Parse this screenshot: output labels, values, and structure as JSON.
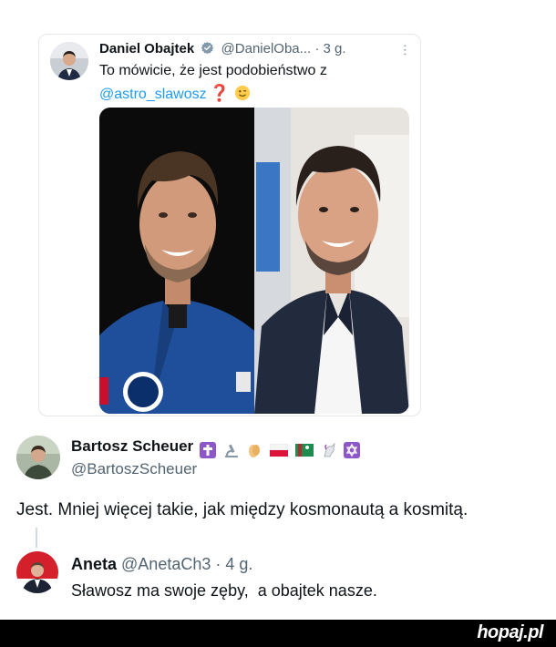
{
  "tweet": {
    "author_name": "Daniel Obajtek",
    "author_handle": "@DanielOba...",
    "separator": "·",
    "time": "3 g.",
    "text_part1": "To mówicie, że jest podobieństwo z",
    "mention": "@astro_slawosz",
    "question_emoji": "❓",
    "icons": [
      "verified-badge-icon",
      "more-options-icon",
      "winking-face-icon"
    ]
  },
  "reply": {
    "author_name": "Bartosz Scheuer",
    "author_handle": "@BartoszScheuer",
    "text": "Jest. Mniej więcej takie, jak między kosmonautą a kosmitą.",
    "name_emojis": [
      "cross-icon",
      "microscope-icon",
      "clapping-hands-icon",
      "poland-flag-icon",
      "turkmenistan-flag-icon",
      "unicorn-icon",
      "star-of-david-icon"
    ]
  },
  "nested_reply": {
    "author_name": "Aneta",
    "author_handle": "@AnetaCh3",
    "separator": "·",
    "time": "4 g.",
    "text": "Sławosz ma swoje zęby,  a obajtek nasze."
  },
  "footer": {
    "logo": "hopaj.pl"
  },
  "colors": {
    "link": "#1d9bf0",
    "secondary_text": "#536471",
    "verified": "#829aab",
    "footer_bg": "#000000"
  }
}
